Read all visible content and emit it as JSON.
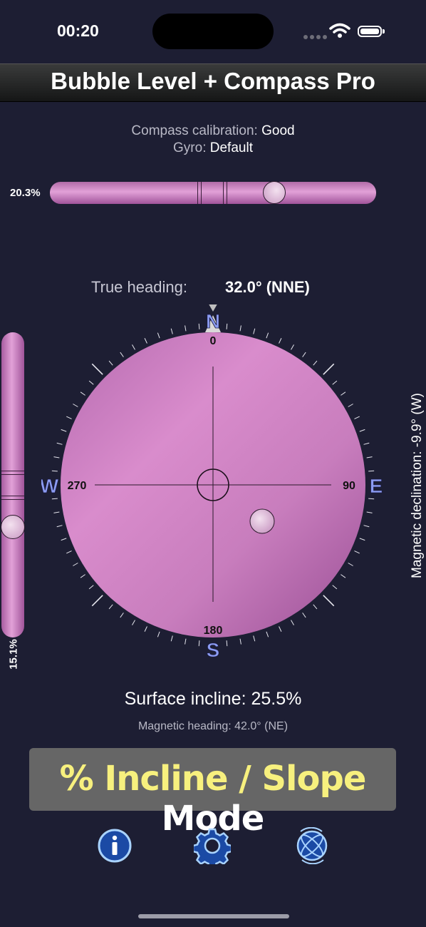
{
  "status_bar": {
    "time": "00:20"
  },
  "app_title": "Bubble Level + Compass Pro",
  "calibration": {
    "compass_label": "Compass calibration:",
    "compass_value": "Good",
    "gyro_label": "Gyro:",
    "gyro_value": "Default"
  },
  "horizontal_level": {
    "percent": "20.3%",
    "bubble_position": 0.703
  },
  "vertical_level": {
    "percent": "15.1%",
    "bubble_position": 0.649
  },
  "heading": {
    "label": "True heading:",
    "value": "32.0° (NNE)"
  },
  "compass": {
    "north": "N",
    "south": "S",
    "east": "E",
    "west": "W",
    "deg_0": "0",
    "deg_90": "90",
    "deg_180": "180",
    "deg_270": "270"
  },
  "magnetic_declination": "Magnetic declination: -9.9° (W)",
  "surface_incline": "Surface incline: 25.5%",
  "magnetic_heading": "Magnetic heading: 42.0° (NE)",
  "mode": {
    "accent_text": "% Incline / Slope",
    "plain_text": "Mode"
  },
  "toolbar": {
    "info_icon": "info-icon",
    "settings_icon": "gear-icon",
    "calibrate_icon": "calibrate-icon"
  },
  "colors": {
    "background": "#1d1e33",
    "level_pink": "#d38bc9",
    "cardinal_blue": "#8c9cf2",
    "mode_yellow": "#f7f07e",
    "mode_box": "#666666"
  }
}
